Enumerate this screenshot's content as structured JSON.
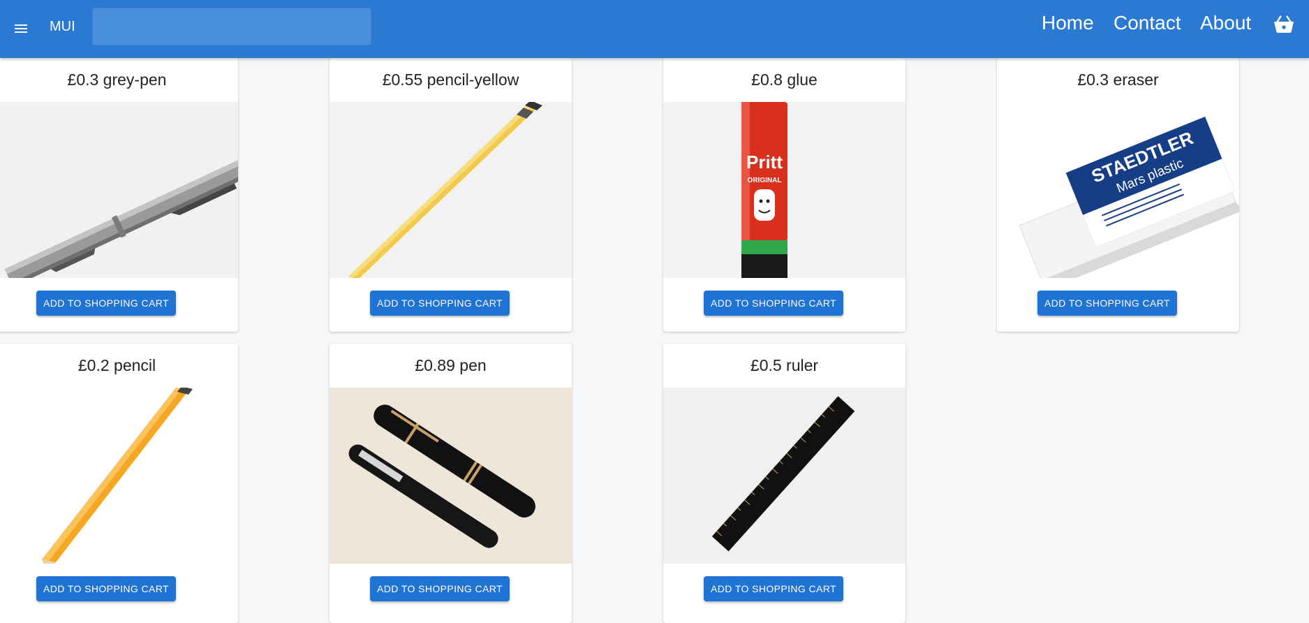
{
  "header": {
    "brand": "MUI",
    "search": {
      "value": "",
      "placeholder": ""
    },
    "nav": [
      "Home",
      "Contact",
      "About"
    ],
    "icons": {
      "menu": "hamburger-menu-icon",
      "cart": "shopping-basket-icon"
    }
  },
  "products": [
    {
      "title": "£0.3 grey-pen",
      "button": "ADD TO SHOPPING CART"
    },
    {
      "title": "£0.55 pencil-yellow",
      "button": "ADD TO SHOPPING CART"
    },
    {
      "title": "£0.8 glue",
      "button": "ADD TO SHOPPING CART"
    },
    {
      "title": "£0.3 eraser",
      "button": "ADD TO SHOPPING CART"
    },
    {
      "title": "£0.2 pencil",
      "button": "ADD TO SHOPPING CART"
    },
    {
      "title": "£0.89 pen",
      "button": "ADD TO SHOPPING CART"
    },
    {
      "title": "£0.5 ruler",
      "button": "ADD TO SHOPPING CART"
    }
  ],
  "image_text": {
    "glue_brand": "Pritt",
    "glue_sub": "ORIGINAL",
    "eraser_brand": "STAEDTLER",
    "eraser_model": "Mars plastic"
  },
  "colors": {
    "appbar": "#2a7ad3",
    "button": "#1e73d3",
    "background": "#f6f7f9"
  }
}
